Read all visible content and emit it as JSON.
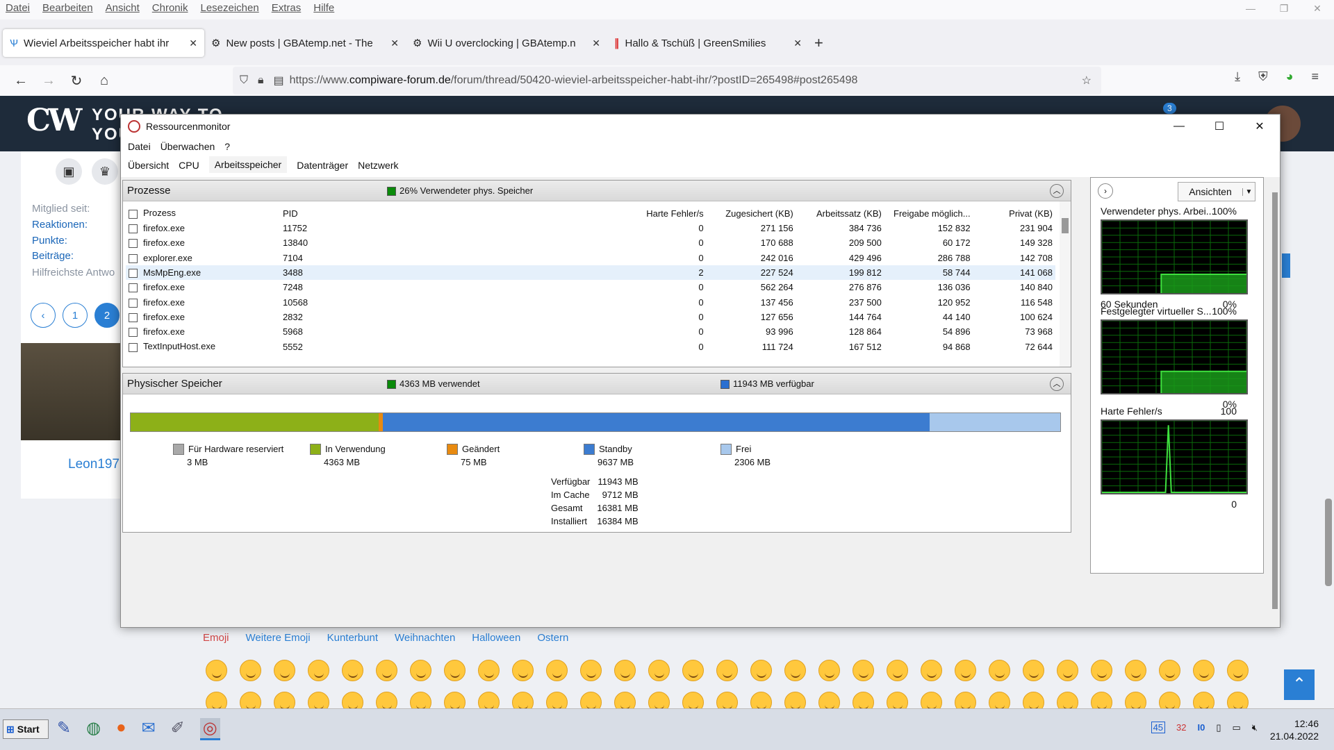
{
  "browser": {
    "menu": [
      "Datei",
      "Bearbeiten",
      "Ansicht",
      "Chronik",
      "Lesezeichen",
      "Extras",
      "Hilfe"
    ],
    "tabs": [
      {
        "title": "Wieviel Arbeitsspeicher habt ihr",
        "active": true
      },
      {
        "title": "New posts | GBAtemp.net - The"
      },
      {
        "title": "Wii U overclocking | GBAtemp.n"
      },
      {
        "title": "Hallo & Tschüß | GreenSmilies"
      }
    ],
    "url_prefix": "https://www.",
    "url_domain": "compiware-forum.de",
    "url_path": "/forum/thread/50420-wieviel-arbeitsspeicher-habt-ihr/?postID=265498#post265498"
  },
  "site": {
    "logo": "CW",
    "logo_text": "YOUR WAY TO\nYOU",
    "notif_count": "3",
    "sidebar_labels": [
      "Mitglied seit:",
      "Reaktionen:",
      "Punkte:",
      "Beiträge:",
      "Hilfreichste Antwo"
    ],
    "pager": [
      "‹",
      "1",
      "2"
    ],
    "username": "Leon197",
    "emoji_tabs": [
      "Emoji",
      "Weitere Emoji",
      "Kunterbunt",
      "Weihnachten",
      "Halloween",
      "Ostern"
    ]
  },
  "rm": {
    "title": "Ressourcenmonitor",
    "menu": [
      "Datei",
      "Überwachen",
      "?"
    ],
    "tabs": [
      "Übersicht",
      "CPU",
      "Arbeitsspeicher",
      "Datenträger",
      "Netzwerk"
    ],
    "active_tab": "Arbeitsspeicher",
    "proc_header": "Prozesse",
    "proc_summary": "26% Verwendeter phys. Speicher",
    "columns": [
      "Prozess",
      "PID",
      "Harte Fehler/s",
      "Zugesichert (KB)",
      "Arbeitssatz (KB)",
      "Freigabe möglich...",
      "Privat (KB)"
    ],
    "processes": [
      [
        "firefox.exe",
        "11752",
        "0",
        "271 156",
        "384 736",
        "152 832",
        "231 904"
      ],
      [
        "firefox.exe",
        "13840",
        "0",
        "170 688",
        "209 500",
        "60 172",
        "149 328"
      ],
      [
        "explorer.exe",
        "7104",
        "0",
        "242 016",
        "429 496",
        "286 788",
        "142 708"
      ],
      [
        "MsMpEng.exe",
        "3488",
        "2",
        "227 524",
        "199 812",
        "58 744",
        "141 068"
      ],
      [
        "firefox.exe",
        "7248",
        "0",
        "562 264",
        "276 876",
        "136 036",
        "140 840"
      ],
      [
        "firefox.exe",
        "10568",
        "0",
        "137 456",
        "237 500",
        "120 952",
        "116 548"
      ],
      [
        "firefox.exe",
        "2832",
        "0",
        "127 656",
        "144 764",
        "44 140",
        "100 624"
      ],
      [
        "firefox.exe",
        "5968",
        "0",
        "93 996",
        "128 864",
        "54 896",
        "73 968"
      ],
      [
        "TextInputHost.exe",
        "5552",
        "0",
        "111 724",
        "167 512",
        "94 868",
        "72 644"
      ]
    ],
    "mem_header": "Physischer Speicher",
    "mem_used": "4363 MB verwendet",
    "mem_avail": "11943 MB verfügbar",
    "legend": [
      {
        "label": "Für Hardware reserviert",
        "value": "3 MB",
        "color": "#a9a9a9",
        "mb": 3
      },
      {
        "label": "In Verwendung",
        "value": "4363 MB",
        "color": "#8db018",
        "mb": 4363
      },
      {
        "label": "Geändert",
        "value": "75 MB",
        "color": "#e88a10",
        "mb": 75
      },
      {
        "label": "Standby",
        "value": "9637 MB",
        "color": "#3c7cd0",
        "mb": 9637
      },
      {
        "label": "Frei",
        "value": "2306 MB",
        "color": "#a8c8ec",
        "mb": 2306
      }
    ],
    "stats": [
      {
        "k": "Verfügbar",
        "v": "11943 MB"
      },
      {
        "k": "Im Cache",
        "v": "9712 MB"
      },
      {
        "k": "Gesamt",
        "v": "16381 MB"
      },
      {
        "k": "Installiert",
        "v": "16384 MB"
      }
    ],
    "views_button": "Ansichten",
    "graphs": [
      {
        "title": "Verwendeter phys. Arbei...",
        "max": "100%",
        "foot_left": "60 Sekunden",
        "foot_right": "0%",
        "level": 0.26
      },
      {
        "title": "Festgelegter virtueller S...",
        "max": "100%",
        "foot_left": "",
        "foot_right": "0%",
        "level": 0.3
      },
      {
        "title": "Harte Fehler/s",
        "max": "100",
        "foot_left": "",
        "foot_right": "0",
        "level": 0
      }
    ]
  },
  "taskbar": {
    "start": "Start",
    "tray_nums": [
      "45",
      "32",
      "I0"
    ],
    "time": "12:46",
    "date": "21.04.2022"
  }
}
